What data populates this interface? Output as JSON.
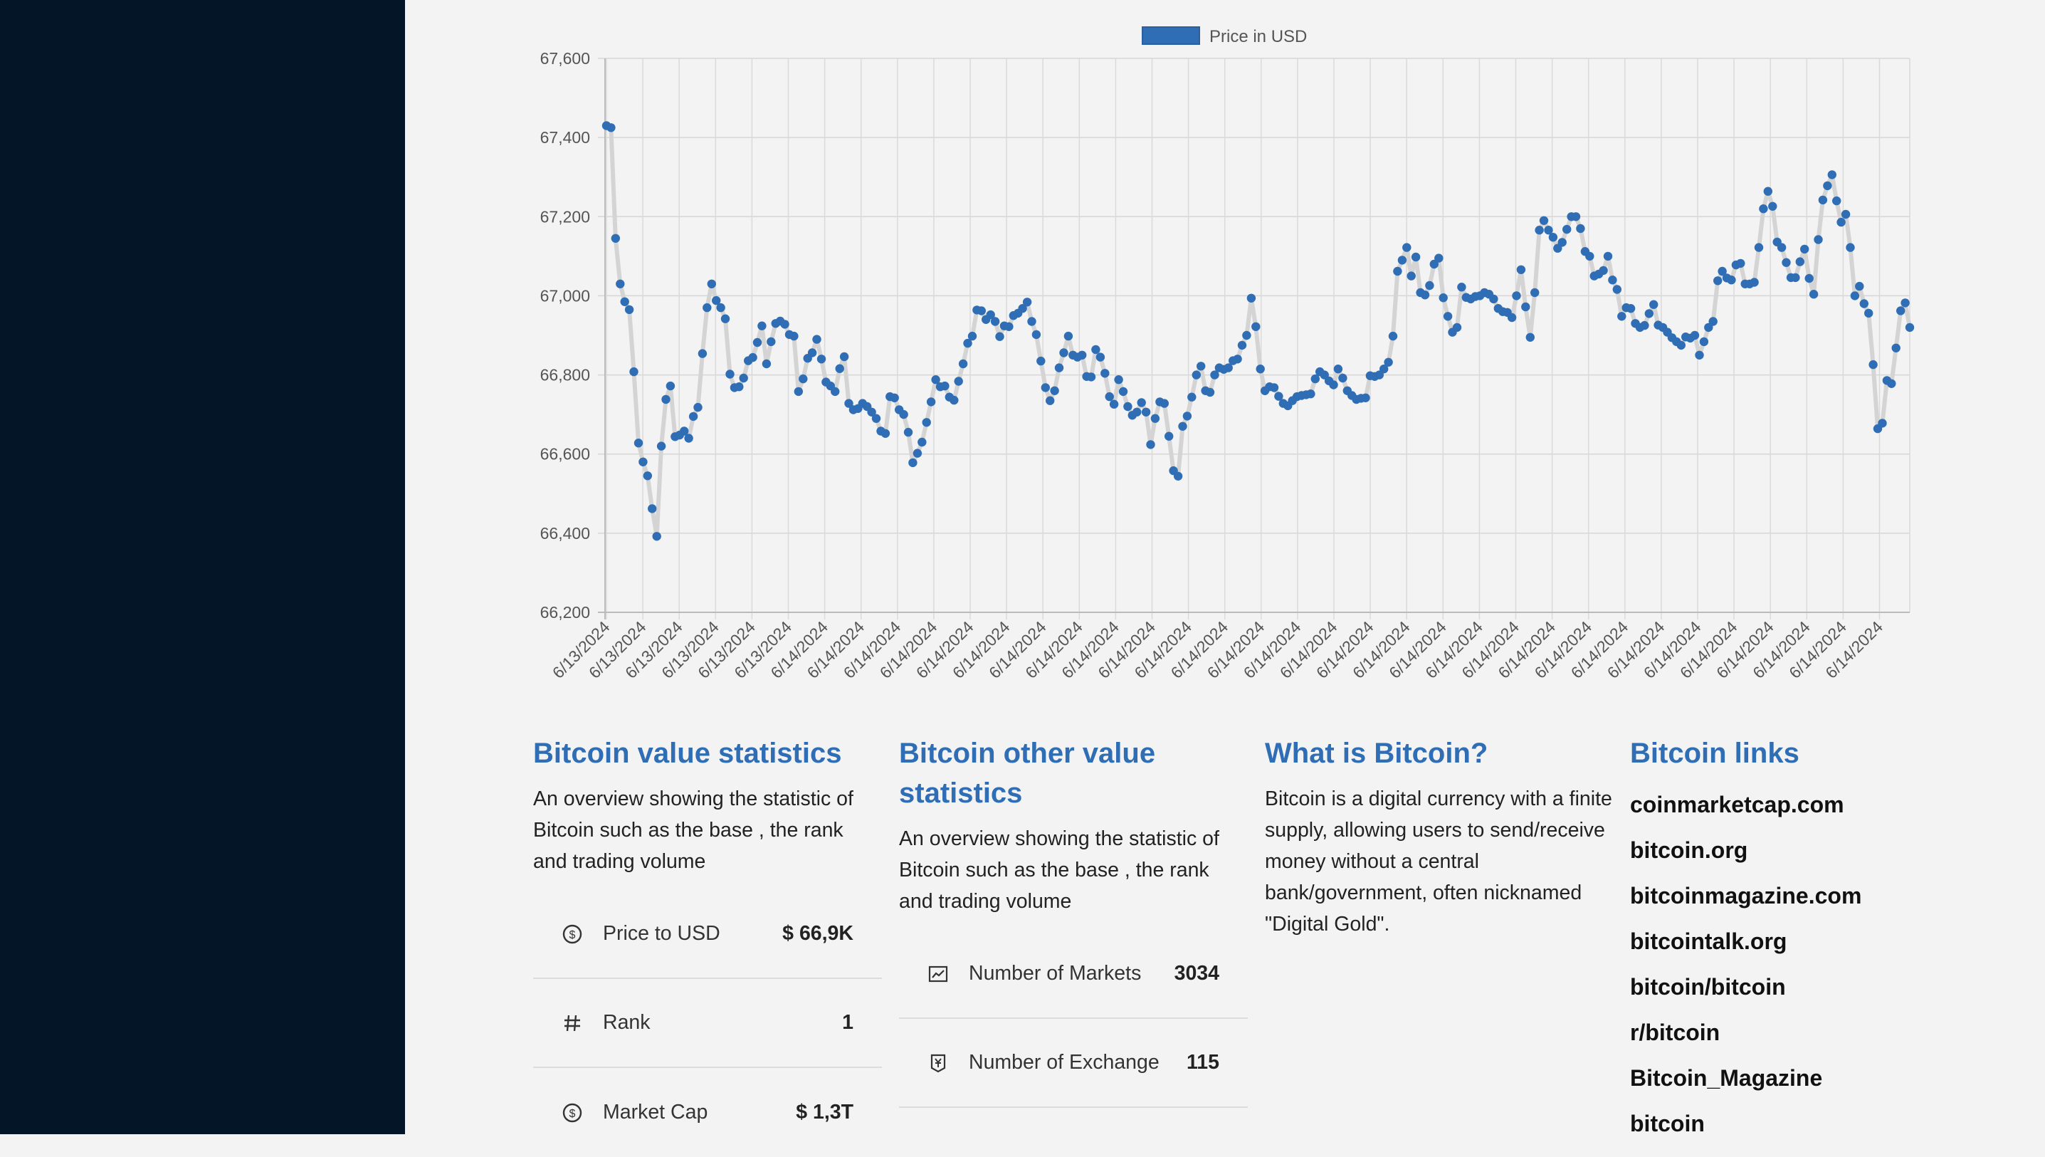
{
  "legend": {
    "label": "Price in USD",
    "color": "#2f6db5"
  },
  "chart_data": {
    "type": "line",
    "series": [
      {
        "name": "Price in USD"
      }
    ],
    "ylim": [
      66200,
      67600
    ],
    "yticks": [
      "67,600",
      "67,400",
      "67,200",
      "67,000",
      "66,800",
      "66,600",
      "66,400",
      "66,200"
    ],
    "xtick_labels": [
      "6/13/2024",
      "6/13/2024",
      "6/13/2024",
      "6/13/2024",
      "6/13/2024",
      "6/13/2024",
      "6/14/2024",
      "6/14/2024",
      "6/14/2024",
      "6/14/2024",
      "6/14/2024",
      "6/14/2024",
      "6/14/2024",
      "6/14/2024",
      "6/14/2024",
      "6/14/2024",
      "6/14/2024",
      "6/14/2024",
      "6/14/2024",
      "6/14/2024",
      "6/14/2024",
      "6/14/2024",
      "6/14/2024",
      "6/14/2024",
      "6/14/2024",
      "6/14/2024",
      "6/14/2024",
      "6/14/2024",
      "6/14/2024",
      "6/14/2024",
      "6/14/2024",
      "6/14/2024",
      "6/14/2024",
      "6/14/2024",
      "6/14/2024",
      "6/14/2024"
    ],
    "values": [
      67430,
      67425,
      67145,
      67030,
      66985,
      66965,
      66808,
      66628,
      66580,
      66545,
      66462,
      66392,
      66620,
      66738,
      66772,
      66644,
      66648,
      66658,
      66640,
      66695,
      66718,
      66854,
      66970,
      67030,
      66988,
      66970,
      66942,
      66802,
      66768,
      66770,
      66792,
      66836,
      66844,
      66882,
      66924,
      66828,
      66884,
      66930,
      66936,
      66928,
      66902,
      66898,
      66758,
      66790,
      66842,
      66856,
      66890,
      66840,
      66782,
      66772,
      66758,
      66816,
      66846,
      66728,
      66712,
      66715,
      66728,
      66720,
      66706,
      66690,
      66658,
      66652,
      66745,
      66742,
      66712,
      66700,
      66655,
      66578,
      66602,
      66630,
      66680,
      66732,
      66788,
      66770,
      66772,
      66744,
      66736,
      66784,
      66828,
      66880,
      66898,
      66964,
      66962,
      66940,
      66952,
      66935,
      66897,
      66924,
      66922,
      66950,
      66956,
      66968,
      66984,
      66935,
      66902,
      66835,
      66768,
      66735,
      66760,
      66818,
      66856,
      66898,
      66850,
      66845,
      66850,
      66796,
      66795,
      66864,
      66845,
      66804,
      66745,
      66726,
      66788,
      66758,
      66720,
      66698,
      66706,
      66730,
      66706,
      66624,
      66690,
      66732,
      66728,
      66645,
      66558,
      66544,
      66670,
      66696,
      66744,
      66800,
      66822,
      66760,
      66756,
      66800,
      66818,
      66814,
      66818,
      66836,
      66840,
      66875,
      66900,
      66994,
      66922,
      66815,
      66760,
      66770,
      66768,
      66746,
      66728,
      66722,
      66735,
      66745,
      66748,
      66750,
      66752,
      66790,
      66808,
      66800,
      66785,
      66775,
      66815,
      66792,
      66760,
      66748,
      66738,
      66741,
      66742,
      66798,
      66796,
      66800,
      66815,
      66832,
      66898,
      67062,
      67090,
      67122,
      67050,
      67098,
      67008,
      67002,
      67026,
      67080,
      67095,
      66995,
      66948,
      66908,
      66920,
      67022,
      66996,
      66992,
      66998,
      67000,
      67008,
      67004,
      66992,
      66968,
      66960,
      66958,
      66945,
      67000,
      67066,
      66972,
      66895,
      67008,
      67166,
      67190,
      67166,
      67148,
      67120,
      67135,
      67168,
      67200,
      67200,
      67170,
      67112,
      67100,
      67050,
      67055,
      67064,
      67100,
      67040,
      67016,
      66948,
      66970,
      66968,
      66930,
      66920,
      66925,
      66955,
      66978,
      66926,
      66920,
      66908,
      66894,
      66884,
      66875,
      66896,
      66893,
      66900,
      66850,
      66884,
      66920,
      66935,
      67038,
      67062,
      67045,
      67040,
      67078,
      67082,
      67030,
      67030,
      67034,
      67122,
      67220,
      67264,
      67226,
      67136,
      67122,
      67084,
      67046,
      67046,
      67086,
      67118,
      67044,
      67004,
      67142,
      67242,
      67278,
      67306,
      67240,
      67186,
      67206,
      67122,
      67000,
      67024,
      66980,
      66956,
      66826,
      66664,
      66678,
      66786,
      66778,
      66868,
      66962,
      66982,
      66920
    ]
  },
  "sections": {
    "value_stats": {
      "title": "Bitcoin value statistics",
      "desc": "An overview showing the statistic of Bitcoin such as the base , the rank and trading volume",
      "rows": [
        {
          "icon": "dollar-circle-icon",
          "label": "Price to USD",
          "value": "$ 66,9K"
        },
        {
          "icon": "hash-icon",
          "label": "Rank",
          "value": "1"
        },
        {
          "icon": "dollar-circle-icon",
          "label": "Market Cap",
          "value": "$ 1,3T"
        }
      ]
    },
    "other_stats": {
      "title": "Bitcoin other value statistics",
      "desc": "An overview showing the statistic of Bitcoin such as the base , the rank and trading volume",
      "rows": [
        {
          "icon": "line-chart-icon",
          "label": "Number of Markets",
          "value": "3034"
        },
        {
          "icon": "money-collect-icon",
          "label": "Number of Exchange",
          "value": "115"
        }
      ]
    },
    "what_is": {
      "title": "What is Bitcoin?",
      "desc": "Bitcoin is a digital currency with a finite supply, allowing users to send/receive money without a central bank/government, often nicknamed \"Digital Gold\"."
    },
    "links": {
      "title": "Bitcoin links",
      "items": [
        "coinmarketcap.com",
        "bitcoin.org",
        "bitcoinmagazine.com",
        "bitcointalk.org",
        "bitcoin/bitcoin",
        "r/bitcoin",
        "Bitcoin_Magazine",
        "bitcoin"
      ]
    }
  }
}
